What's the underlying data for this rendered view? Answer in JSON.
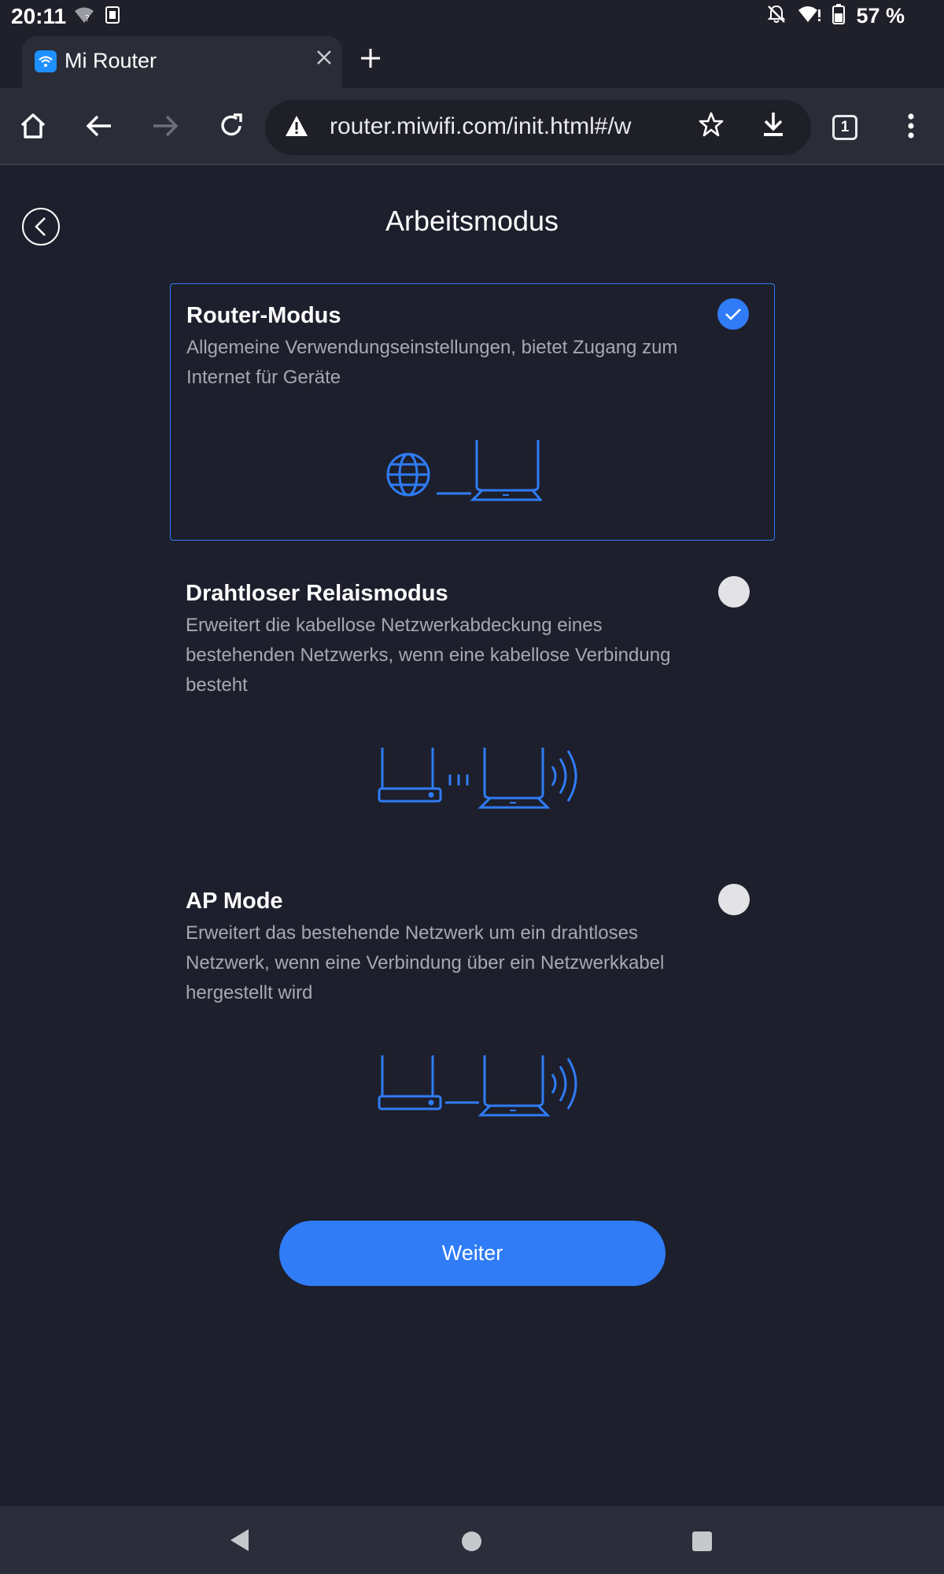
{
  "status_bar": {
    "time": "20:11",
    "battery_text": "57 %"
  },
  "browser": {
    "tab_title": "Mi Router",
    "url": "router.miwifi.com/init.html#/w",
    "tab_count": "1"
  },
  "page": {
    "title": "Arbeitsmodus",
    "modes": [
      {
        "title": "Router-Modus",
        "description": "Allgemeine Verwendungseinstellungen, bietet Zugang zum Internet für Geräte",
        "selected": true
      },
      {
        "title": "Drahtloser Relaismodus",
        "description": "Erweitert die kabellose Netzwerkabdeckung eines bestehenden Netzwerks, wenn eine kabellose Verbindung besteht",
        "selected": false
      },
      {
        "title": "AP Mode",
        "description": "Erweitert das bestehende Netzwerk um ein drahtloses Netzwerk, wenn eine Verbindung über ein Netzwerkkabel hergestellt wird",
        "selected": false
      }
    ],
    "next_button": "Weiter"
  },
  "colors": {
    "accent": "#2f7cf6",
    "background": "#1d1f2c",
    "description_text": "#a6a8b2"
  }
}
